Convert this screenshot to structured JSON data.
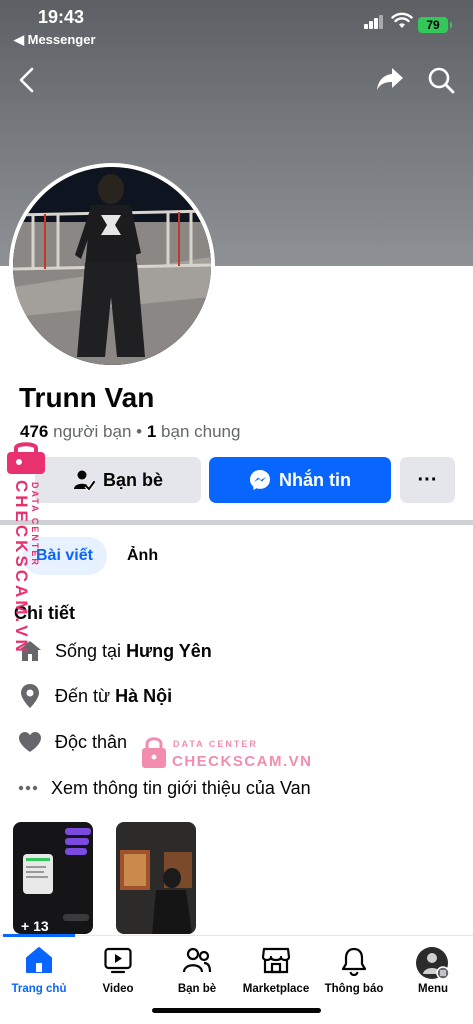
{
  "status_bar": {
    "time": "19:43",
    "back_app": "◀ Messenger",
    "battery": "79"
  },
  "profile": {
    "name": "Trunn Van",
    "friends_count": "476",
    "friends_label": "người bạn",
    "mutual_count": "1",
    "mutual_label": "bạn chung"
  },
  "actions": {
    "friends_button": "Bạn bè",
    "message_button": "Nhắn tin",
    "more_button": "···"
  },
  "tabs": {
    "posts": "Bài viết",
    "photos": "Ảnh"
  },
  "details": {
    "heading": "Chi tiết",
    "lives_prefix": "Sống tại",
    "lives_value": "Hưng Yên",
    "from_prefix": "Đến từ",
    "from_value": "Hà Nội",
    "relationship": "Độc thân",
    "see_about": "Xem thông tin giới thiệu của Van"
  },
  "thumbnails": {
    "first_overlay": "+ 13"
  },
  "watermark": {
    "brand": "CHECKSCAM.VN",
    "tagline": "DATA CENTER"
  },
  "bottom_nav": [
    {
      "label": "Trang chủ",
      "icon": "home-icon",
      "active": true
    },
    {
      "label": "Video",
      "icon": "video-icon",
      "active": false
    },
    {
      "label": "Bạn bè",
      "icon": "friends-icon",
      "active": false
    },
    {
      "label": "Marketplace",
      "icon": "marketplace-icon",
      "active": false
    },
    {
      "label": "Thông báo",
      "icon": "bell-icon",
      "active": false
    },
    {
      "label": "Menu",
      "icon": "menu-avatar-icon",
      "active": false
    }
  ],
  "colors": {
    "accent": "#0866ff",
    "watermark": "#e8316f"
  }
}
